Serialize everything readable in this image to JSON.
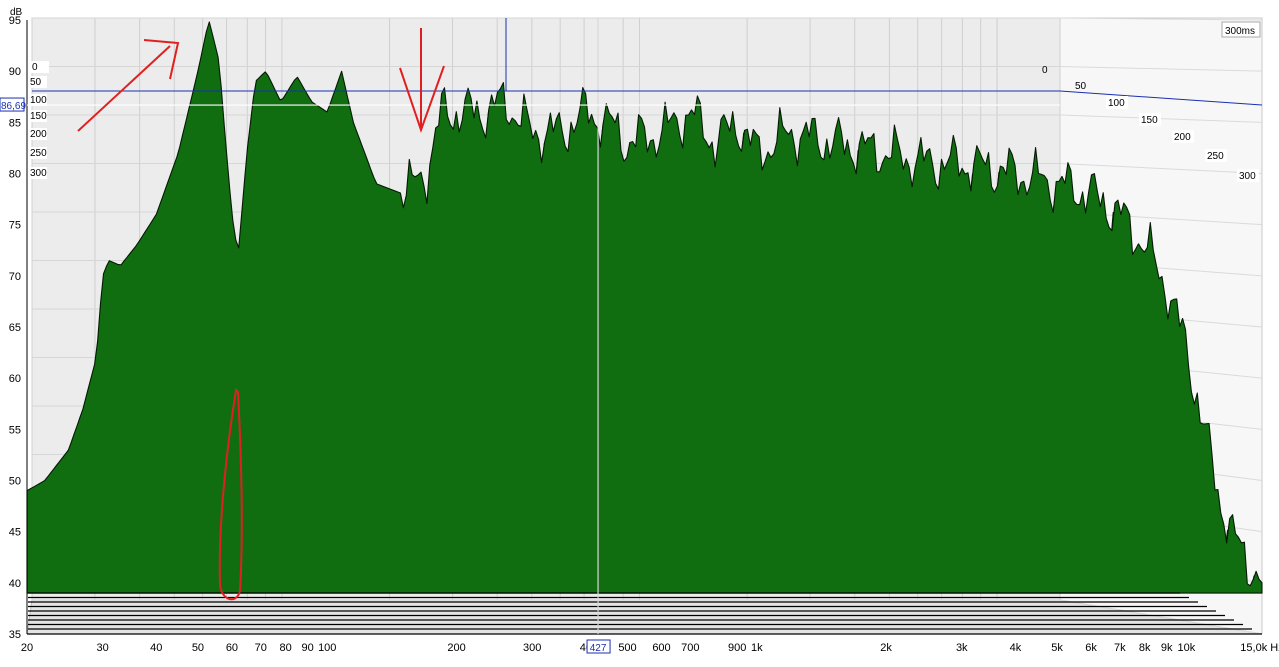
{
  "chart_data": {
    "type": "area",
    "title": "",
    "xlabel": "",
    "ylabel": "",
    "x_scale": "log",
    "xlim": [
      20,
      15000
    ],
    "ylim": [
      35,
      95
    ],
    "y_unit": "dB",
    "y_ticks": [
      "95",
      "90",
      "85",
      "80",
      "75",
      "70",
      "65",
      "60",
      "55",
      "50",
      "45",
      "40",
      "35"
    ],
    "x_ticks": [
      {
        "f": 20,
        "label": "20"
      },
      {
        "f": 30,
        "label": "30"
      },
      {
        "f": 40,
        "label": "40"
      },
      {
        "f": 50,
        "label": "50"
      },
      {
        "f": 60,
        "label": "60"
      },
      {
        "f": 70,
        "label": "70"
      },
      {
        "f": 80,
        "label": "80"
      },
      {
        "f": 90,
        "label": "90"
      },
      {
        "f": 100,
        "label": "100"
      },
      {
        "f": 200,
        "label": "200"
      },
      {
        "f": 300,
        "label": "300"
      },
      {
        "f": 400,
        "label": "40"
      },
      {
        "f": 500,
        "label": "500"
      },
      {
        "f": 600,
        "label": "600"
      },
      {
        "f": 700,
        "label": "700"
      },
      {
        "f": 900,
        "label": "900"
      },
      {
        "f": 1000,
        "label": "1k"
      },
      {
        "f": 2000,
        "label": "2k"
      },
      {
        "f": 3000,
        "label": "3k"
      },
      {
        "f": 4000,
        "label": "4k"
      },
      {
        "f": 5000,
        "label": "5k"
      },
      {
        "f": 6000,
        "label": "6k"
      },
      {
        "f": 7000,
        "label": "7k"
      },
      {
        "f": 8000,
        "label": "8k"
      },
      {
        "f": 9000,
        "label": "9k"
      },
      {
        "f": 10000,
        "label": "10k"
      },
      {
        "f": 15000,
        "label": "15,0k Hz"
      }
    ],
    "time_ticks_left": [
      "0",
      "50",
      "100",
      "150",
      "200",
      "250",
      "300"
    ],
    "time_ticks_back": [
      "0",
      "50"
    ],
    "time_ticks_right": [
      "100",
      "150",
      "200",
      "250",
      "300"
    ],
    "time_range_label": "300ms",
    "cursor": {
      "freq_label": "427",
      "freq": 427,
      "level_label": "86,69",
      "level": 86.69
    },
    "series_count": 18,
    "front_slice": {
      "name": "",
      "points": [
        [
          20,
          49
        ],
        [
          22,
          50
        ],
        [
          25,
          53
        ],
        [
          27,
          57
        ],
        [
          29,
          62
        ],
        [
          30,
          70
        ],
        [
          31,
          71.5
        ],
        [
          33,
          71
        ],
        [
          36,
          73
        ],
        [
          40,
          76
        ],
        [
          45,
          82
        ],
        [
          50,
          90
        ],
        [
          53,
          95
        ],
        [
          56,
          91
        ],
        [
          58,
          83
        ],
        [
          60,
          76
        ],
        [
          62,
          72
        ],
        [
          65,
          82
        ],
        [
          68,
          89
        ],
        [
          72,
          90
        ],
        [
          78,
          87
        ],
        [
          85,
          89.5
        ],
        [
          92,
          87
        ],
        [
          100,
          86
        ],
        [
          108,
          90
        ],
        [
          115,
          85
        ],
        [
          130,
          79
        ],
        [
          150,
          78
        ],
        [
          170,
          80
        ],
        [
          185,
          86
        ],
        [
          200,
          86
        ],
        [
          230,
          86
        ],
        [
          260,
          87
        ],
        [
          300,
          84
        ],
        [
          350,
          84
        ],
        [
          400,
          86
        ],
        [
          450,
          85
        ],
        [
          500,
          83
        ],
        [
          600,
          84
        ],
        [
          700,
          86
        ],
        [
          800,
          83
        ],
        [
          900,
          85
        ],
        [
          1000,
          82
        ],
        [
          1200,
          84
        ],
        [
          1500,
          83
        ],
        [
          2000,
          82
        ],
        [
          2500,
          81
        ],
        [
          3000,
          81
        ],
        [
          4000,
          80
        ],
        [
          5000,
          79
        ],
        [
          6000,
          78
        ],
        [
          7000,
          76
        ],
        [
          8000,
          73
        ],
        [
          9000,
          69
        ],
        [
          10000,
          63
        ],
        [
          11000,
          55
        ],
        [
          12000,
          48
        ],
        [
          13000,
          44
        ],
        [
          15000,
          40
        ]
      ]
    },
    "annotation_color": "#e02020",
    "fill_color": "#0a6a0a"
  }
}
